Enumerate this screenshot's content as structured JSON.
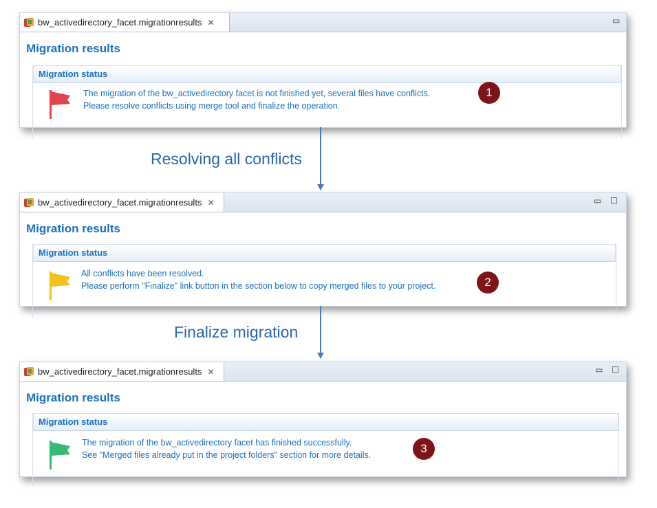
{
  "panels": [
    {
      "tab_title": "bw_activedirectory_facet.migrationresults",
      "page_title": "Migration results",
      "section_title": "Migration status",
      "flag_color": "#e2434e",
      "message_line1": "The migration of the bw_activedirectory facet is not finished yet, several files have conflicts.",
      "message_line2": "Please resolve conflicts using merge tool and finalize the operation.",
      "badge": "1",
      "window_controls": [
        "minimize"
      ]
    },
    {
      "tab_title": "bw_activedirectory_facet.migrationresults",
      "page_title": "Migration results",
      "section_title": "Migration status",
      "flag_color": "#f2c21b",
      "message_line1": "All conflicts have been resolved.",
      "message_line2": "Please perform \"Finalize\" link button in the section below to copy merged files to your project.",
      "badge": "2",
      "window_controls": [
        "minimize",
        "maximize"
      ]
    },
    {
      "tab_title": "bw_activedirectory_facet.migrationresults",
      "page_title": "Migration results",
      "section_title": "Migration status",
      "flag_color": "#3ab878",
      "message_line1": "The migration of the bw_activedirectory facet has finished successfully.",
      "message_line2": "See \"Merged files already put in the project folders\" section for more details.",
      "badge": "3",
      "window_controls": [
        "minimize",
        "maximize"
      ]
    }
  ],
  "steps": [
    {
      "label": "Resolving all conflicts"
    },
    {
      "label": "Finalize migration"
    }
  ],
  "icons": {
    "tab": "facet-file-icon",
    "close": "close-icon",
    "minimize": "minimize-icon",
    "maximize": "maximize-icon",
    "flag": "flag-icon"
  },
  "colors": {
    "title_blue": "#1a6fc0",
    "arrow_blue": "#4a78b8",
    "badge_bg": "#7c1418"
  }
}
